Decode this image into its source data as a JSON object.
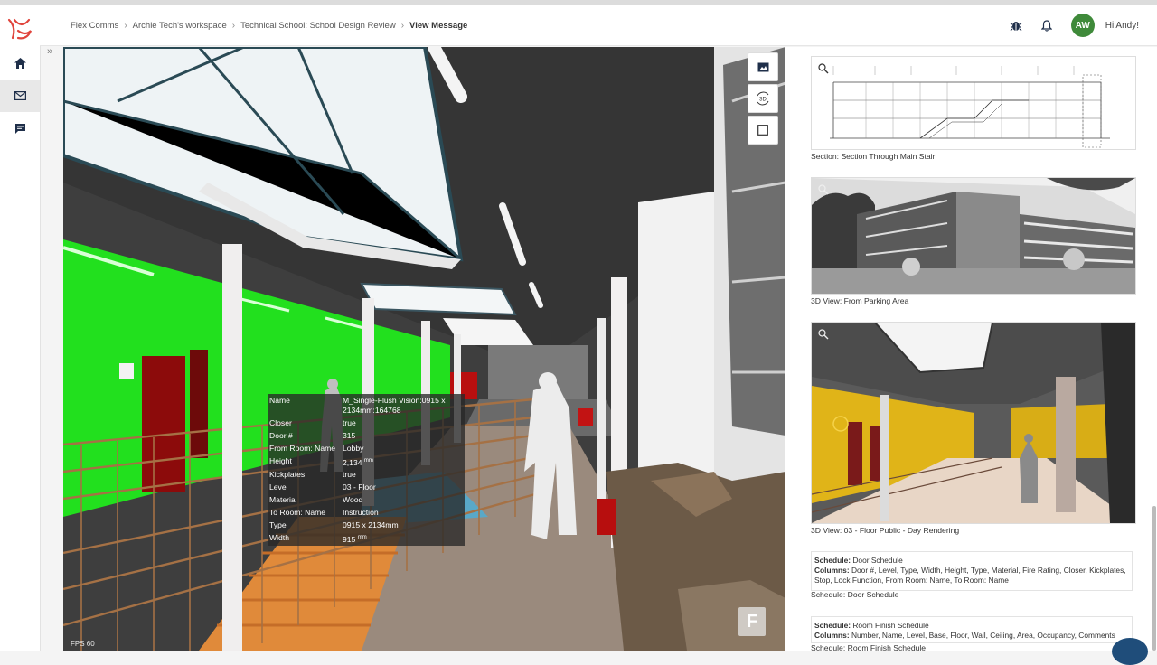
{
  "breadcrumb": {
    "items": [
      "Flex Comms",
      "Archie Tech's workspace",
      "Technical School: School Design Review",
      "View Message"
    ]
  },
  "header": {
    "avatar_initials": "AW",
    "greeting": "Hi Andy!"
  },
  "sidebar": {
    "items": [
      {
        "name": "home",
        "icon": "home-icon"
      },
      {
        "name": "messages",
        "icon": "envelope-icon",
        "active": true
      },
      {
        "name": "comments",
        "icon": "chat-icon"
      }
    ]
  },
  "viewer": {
    "fps": "FPS 60",
    "key_badge": "F",
    "tools": [
      "image-icon",
      "rotate-3d-icon",
      "square-icon"
    ],
    "tool_3d_label": "3D",
    "properties": [
      {
        "key": "Name",
        "value": "M_Single-Flush Vision:0915 x 2134mm:164768"
      },
      {
        "key": "Closer",
        "value": "true"
      },
      {
        "key": "Door #",
        "value": "315"
      },
      {
        "key": "From Room: Name",
        "value": "Lobby"
      },
      {
        "key": "Height",
        "value": "2,134",
        "unit": "mm"
      },
      {
        "key": "Kickplates",
        "value": "true"
      },
      {
        "key": "Level",
        "value": "03 - Floor"
      },
      {
        "key": "Material",
        "value": "Wood"
      },
      {
        "key": "To Room: Name",
        "value": "Instruction"
      },
      {
        "key": "Type",
        "value": "0915 x 2134mm"
      },
      {
        "key": "Width",
        "value": "915",
        "unit": "mm"
      }
    ]
  },
  "panel": {
    "views": [
      {
        "caption": "Section: Section Through Main Stair"
      },
      {
        "caption": "3D View: From Parking Area"
      },
      {
        "caption": "3D View: 03 - Floor Public - Day Rendering"
      }
    ],
    "schedules": [
      {
        "schedule_label": "Schedule:",
        "schedule_name": "Door Schedule",
        "columns_label": "Columns:",
        "columns": "Door #, Level, Type, Width, Height, Type, Material, Fire Rating, Closer, Kickplates, Stop, Lock Function, From Room: Name, To Room: Name",
        "caption": "Schedule: Door Schedule"
      },
      {
        "schedule_label": "Schedule:",
        "schedule_name": "Room Finish Schedule",
        "columns_label": "Columns:",
        "columns": "Number, Name, Level, Base, Floor, Wall, Ceiling, Area, Occupancy, Comments",
        "caption": "Schedule: Room Finish Schedule"
      }
    ]
  },
  "colors": {
    "accent_green_wall": "#22e01e",
    "avatar_bg": "#3f8a3a",
    "logo": "#e0443c"
  }
}
